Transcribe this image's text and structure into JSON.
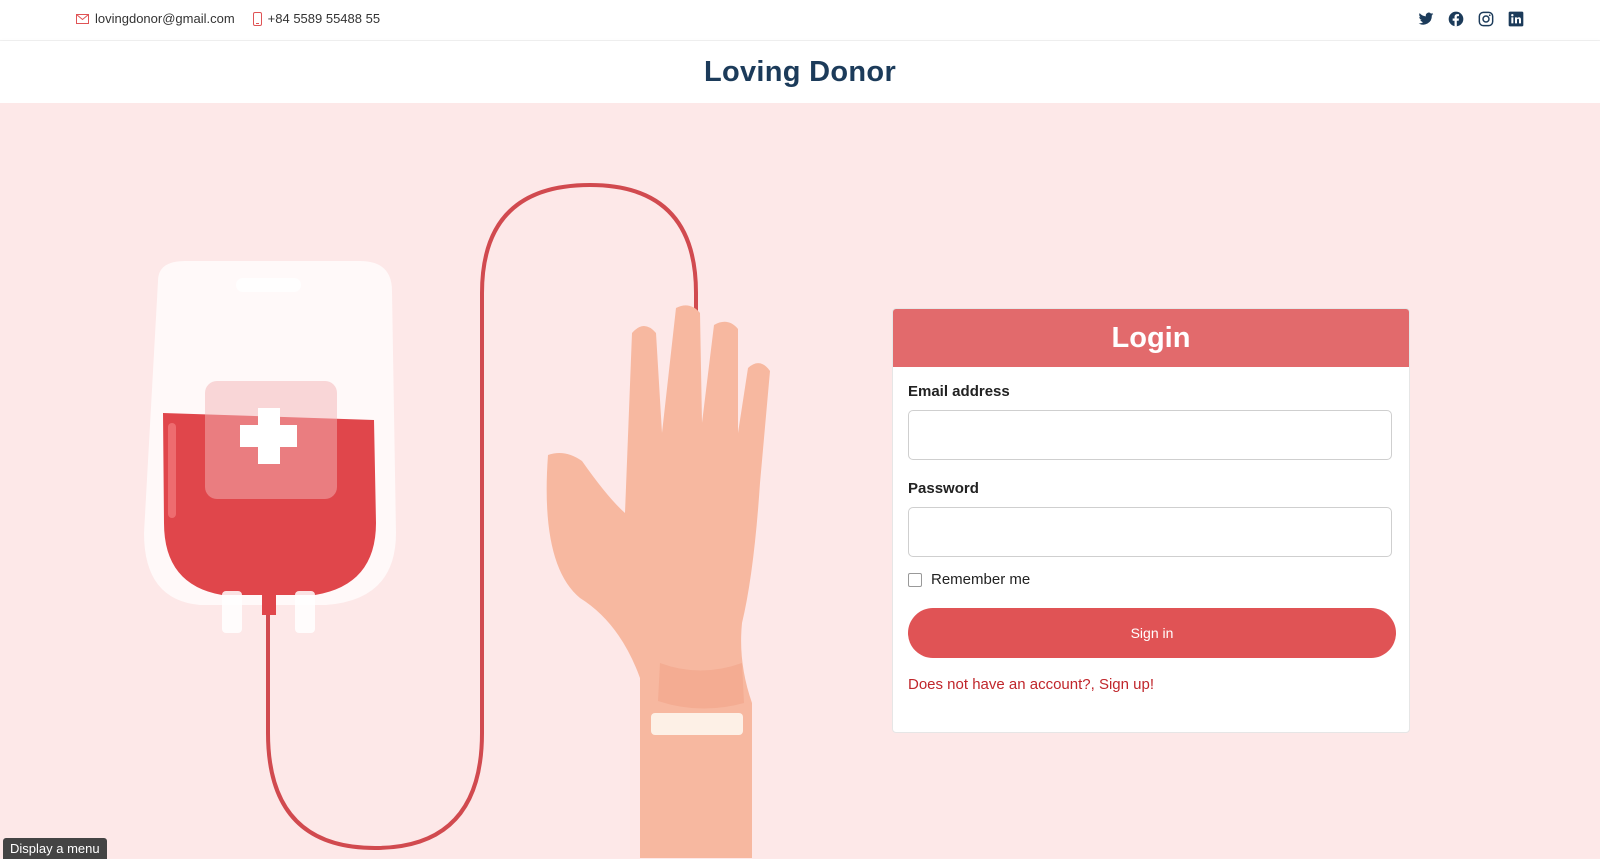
{
  "topbar": {
    "email": "lovingdonor@gmail.com",
    "phone": "+84 5589 55488 55",
    "social_icons": [
      "twitter-icon",
      "facebook-icon",
      "instagram-icon",
      "linkedin-icon"
    ]
  },
  "header": {
    "brand": "Loving Donor"
  },
  "login": {
    "title": "Login",
    "email_label": "Email address",
    "email_value": "",
    "password_label": "Password",
    "password_value": "",
    "remember_label": "Remember me",
    "signin_label": "Sign in",
    "signup_text": "Does not have an account?, Sign up!"
  },
  "footer": {
    "menu_label": "Display a menu"
  },
  "colors": {
    "brand": "#1c3b5a",
    "accent": "#e05355",
    "card_header": "#e26a6c",
    "background": "#fde8e8",
    "link": "#c0262b"
  }
}
